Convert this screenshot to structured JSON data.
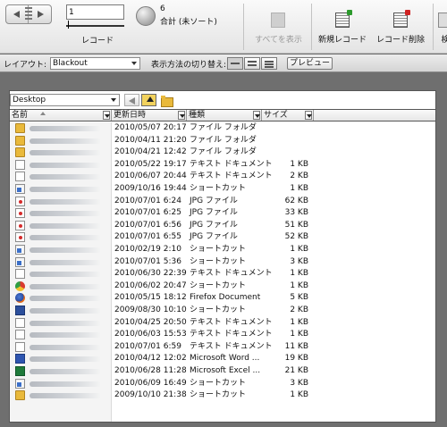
{
  "toolbar": {
    "record_value": "1",
    "record_label": "レコード",
    "count": "6",
    "sort_status": "合計 (未ソート)",
    "show_all_label": "すべてを表示",
    "new_record_label": "新規レコード",
    "delete_record_label": "レコード削除",
    "find_label": "検"
  },
  "layoutbar": {
    "layout_label": "レイアウト:",
    "layout_value": "Blackout",
    "view_label": "表示方法の切り替え:",
    "preview_label": "プレビュー"
  },
  "browser": {
    "path": "Desktop",
    "columns": [
      "名前",
      "更新日時",
      "種類",
      "サイズ"
    ],
    "rows": [
      {
        "icon": "folder-icon",
        "date": "2010/05/07 20:17",
        "kind": "ファイル フォルダ",
        "size": ""
      },
      {
        "icon": "folder-icon",
        "date": "2010/04/11 21:20",
        "kind": "ファイル フォルダ",
        "size": ""
      },
      {
        "icon": "folder-icon",
        "date": "2010/04/21 12:42",
        "kind": "ファイル フォルダ",
        "size": ""
      },
      {
        "icon": "text-document-icon",
        "date": "2010/05/22 19:17",
        "kind": "テキスト ドキュメント",
        "size": "1 KB"
      },
      {
        "icon": "text-document-icon",
        "date": "2010/06/07 20:44",
        "kind": "テキスト ドキュメント",
        "size": "2 KB"
      },
      {
        "icon": "shortcut-icon",
        "date": "2009/10/16 19:44",
        "kind": "ショートカット",
        "size": "1 KB"
      },
      {
        "icon": "jpg-file-icon",
        "date": "2010/07/01 6:24",
        "kind": "JPG ファイル",
        "size": "62 KB"
      },
      {
        "icon": "jpg-file-icon",
        "date": "2010/07/01 6:25",
        "kind": "JPG ファイル",
        "size": "33 KB"
      },
      {
        "icon": "jpg-file-icon",
        "date": "2010/07/01 6:56",
        "kind": "JPG ファイル",
        "size": "51 KB"
      },
      {
        "icon": "jpg-file-icon",
        "date": "2010/07/01 6:55",
        "kind": "JPG ファイル",
        "size": "52 KB"
      },
      {
        "icon": "shortcut-icon",
        "date": "2010/02/19 2:10",
        "kind": "ショートカット",
        "size": "1 KB"
      },
      {
        "icon": "shortcut-icon",
        "date": "2010/07/01 5:36",
        "kind": "ショートカット",
        "size": "3 KB"
      },
      {
        "icon": "text-document-icon",
        "date": "2010/06/30 22:39",
        "kind": "テキスト ドキュメント",
        "size": "1 KB"
      },
      {
        "icon": "chrome-shortcut-icon",
        "date": "2010/06/02 20:47",
        "kind": "ショートカット",
        "size": "1 KB"
      },
      {
        "icon": "firefox-document-icon",
        "date": "2010/05/15 18:12",
        "kind": "Firefox Document",
        "size": "5 KB"
      },
      {
        "icon": "app-shortcut-icon",
        "date": "2009/08/30 10:10",
        "kind": "ショートカット",
        "size": "2 KB"
      },
      {
        "icon": "text-document-icon",
        "date": "2010/04/25 20:50",
        "kind": "テキスト ドキュメント",
        "size": "1 KB"
      },
      {
        "icon": "text-document-icon",
        "date": "2010/06/03 15:53",
        "kind": "テキスト ドキュメント",
        "size": "1 KB"
      },
      {
        "icon": "text-document-icon",
        "date": "2010/07/01 6:59",
        "kind": "テキスト ドキュメント",
        "size": "11 KB"
      },
      {
        "icon": "word-document-icon",
        "date": "2010/04/12 12:02",
        "kind": "Microsoft Word ...",
        "size": "19 KB"
      },
      {
        "icon": "excel-document-icon",
        "date": "2010/06/28 11:28",
        "kind": "Microsoft Excel ...",
        "size": "21 KB"
      },
      {
        "icon": "shortcut-icon",
        "date": "2010/06/09 16:49",
        "kind": "ショートカット",
        "size": "3 KB"
      },
      {
        "icon": "folder-shortcut-icon",
        "date": "2009/10/10 21:38",
        "kind": "ショートカット",
        "size": "1 KB"
      }
    ]
  }
}
